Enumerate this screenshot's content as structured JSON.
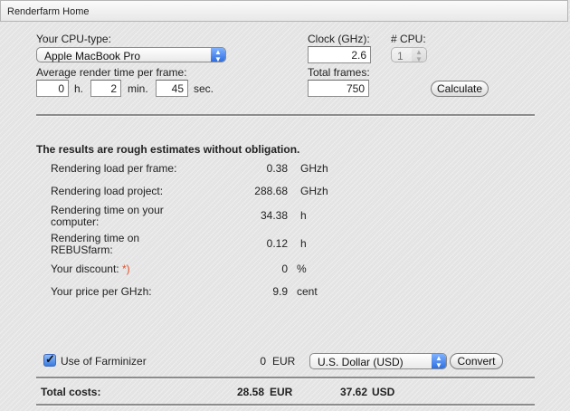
{
  "window": {
    "title": "Renderfarm Home"
  },
  "form": {
    "cpu_type_label": "Your CPU-type:",
    "cpu_type_value": "Apple MacBook Pro",
    "clock_label": "Clock (GHz):",
    "clock_value": "2.6",
    "cpu_count_label": "# CPU:",
    "cpu_count_value": "1",
    "avg_time_label": "Average render time per frame:",
    "hours_value": "0",
    "hours_unit": "h.",
    "minutes_value": "2",
    "minutes_unit": "min.",
    "seconds_value": "45",
    "seconds_unit": "sec.",
    "total_frames_label": "Total frames:",
    "total_frames_value": "750",
    "calculate_label": "Calculate"
  },
  "results": {
    "heading": "The results are rough estimates without obligation.",
    "rows": [
      {
        "label": "Rendering load per frame:",
        "value": "0.38",
        "unit": "GHzh"
      },
      {
        "label": "Rendering load project:",
        "value": "288.68",
        "unit": "GHzh"
      },
      {
        "label_line1": "Rendering time on your",
        "label_line2": "computer:",
        "value": "34.38",
        "unit": "h"
      },
      {
        "label_line1": "Rendering time on",
        "label_line2": "REBUSfarm:",
        "value": "0.12",
        "unit": "h"
      },
      {
        "label": "Your discount:",
        "marker": "*)",
        "value": "0",
        "unit": "%"
      },
      {
        "label": "Your price per GHzh:",
        "value": "9.9",
        "unit": "cent"
      }
    ]
  },
  "farminizer": {
    "label": "Use of Farminizer",
    "checked": true,
    "value": "0",
    "unit": "EUR",
    "currency_select": "U.S. Dollar (USD)",
    "convert_label": "Convert"
  },
  "total": {
    "label": "Total costs:",
    "eur_value": "28.58",
    "eur_unit": "EUR",
    "usd_value": "37.62",
    "usd_unit": "USD"
  },
  "colors": {
    "accent_blue": "#2f6fe0",
    "discount_marker": "#e0502a",
    "checkbox_blue": "#3a7be0"
  }
}
